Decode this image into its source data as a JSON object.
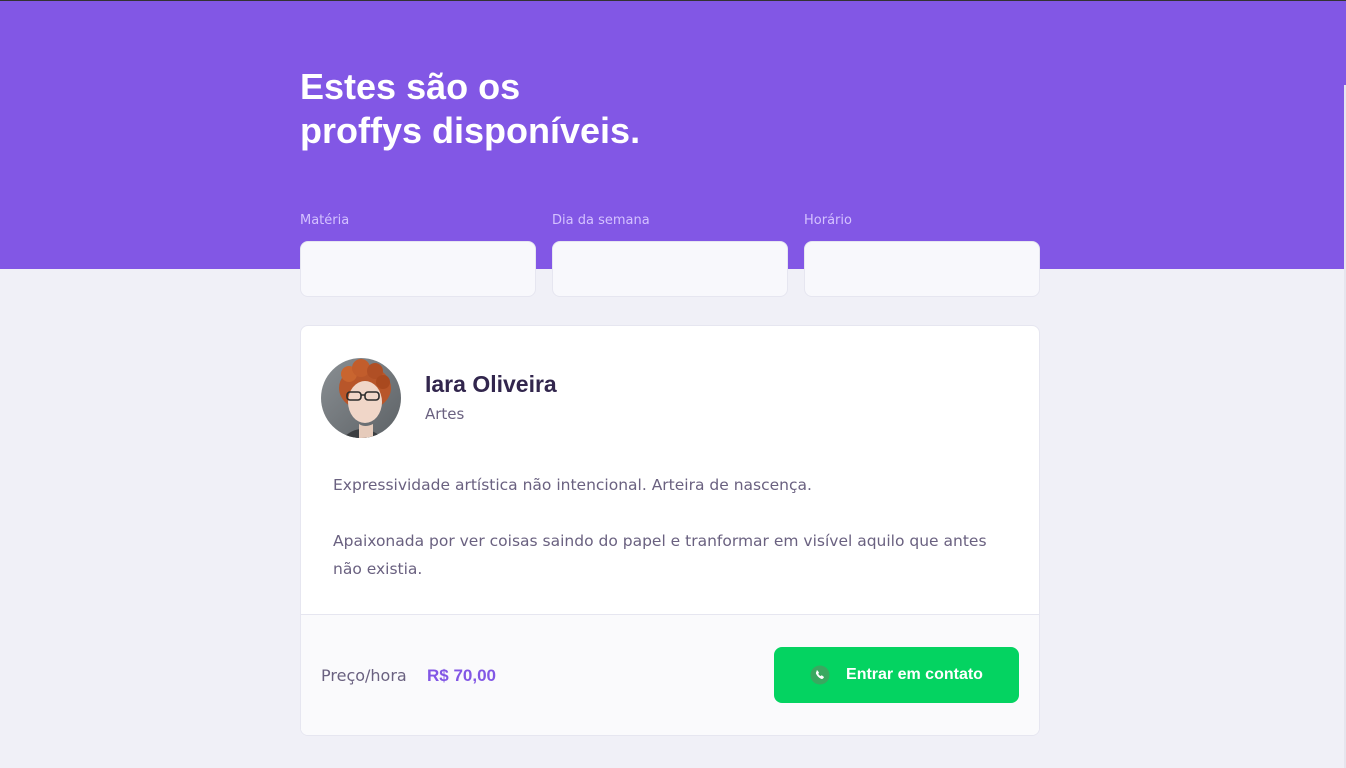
{
  "header": {
    "title_line1": "Estes são os",
    "title_line2": "proffys disponíveis."
  },
  "filters": [
    {
      "label": "Matéria",
      "value": ""
    },
    {
      "label": "Dia da semana",
      "value": ""
    },
    {
      "label": "Horário",
      "value": ""
    }
  ],
  "teacher": {
    "name": "Iara Oliveira",
    "subject": "Artes",
    "bio": [
      "Expressividade artística não intencional. Arteira de nascença.",
      "Apaixonada por ver coisas saindo do papel e tranformar em visível aquilo que antes não existia."
    ],
    "avatar": "avatar-photo"
  },
  "footer": {
    "price_label": "Preço/hora",
    "price_value": "R$ 70,00",
    "contact_label": "Entrar em contato",
    "contact_icon": "whatsapp-icon"
  },
  "colors": {
    "primary": "#8257E5",
    "background": "#F0F0F7",
    "title": "#32264D",
    "text": "#6A6180",
    "secondary": "#04D361"
  }
}
